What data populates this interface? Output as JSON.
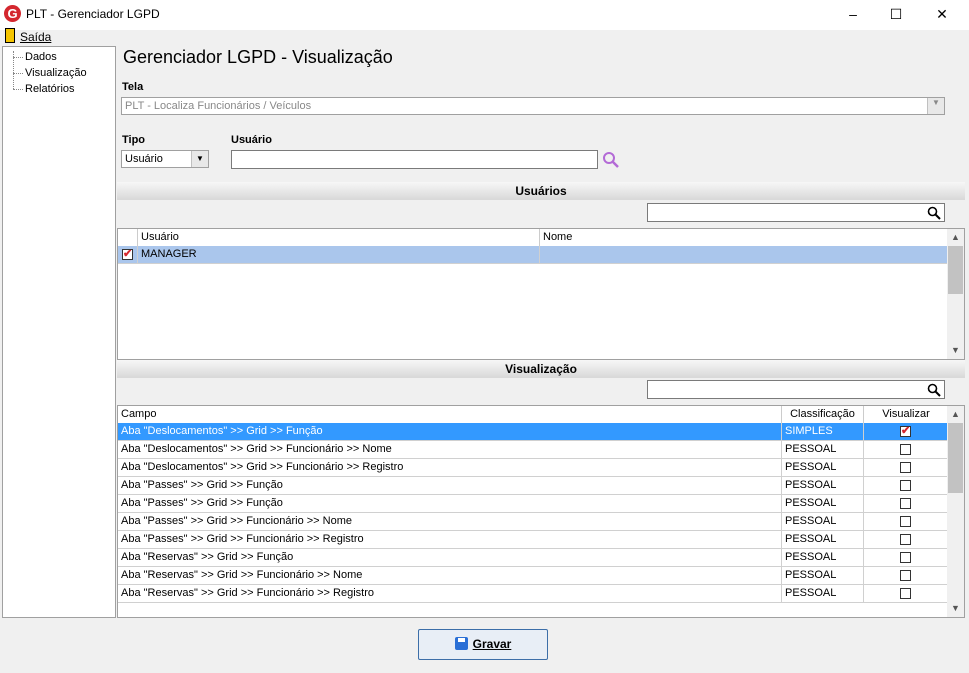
{
  "window": {
    "title": "PLT - Gerenciador LGPD",
    "logo_letter": "G",
    "minimize": "–",
    "maximize": "☐",
    "close": "✕"
  },
  "menu": {
    "saida": "Saída"
  },
  "tree": {
    "items": [
      "Dados",
      "Visualização",
      "Relatórios"
    ]
  },
  "page": {
    "title": "Gerenciador LGPD - Visualização"
  },
  "tela": {
    "label": "Tela",
    "value": "PLT - Localiza Funcionários / Veículos"
  },
  "tipo": {
    "label": "Tipo",
    "value": "Usuário"
  },
  "usuario": {
    "label": "Usuário",
    "value": ""
  },
  "usuarios_section": {
    "title": "Usuários",
    "columns": [
      "Usuário",
      "Nome"
    ],
    "rows": [
      {
        "checked": true,
        "usuario": "MANAGER",
        "nome": ""
      }
    ]
  },
  "visualizacao_section": {
    "title": "Visualização",
    "columns": [
      "Campo",
      "Classificação",
      "Visualizar"
    ],
    "rows": [
      {
        "campo": "Aba \"Deslocamentos\" >> Grid >> Função",
        "classificacao": "SIMPLES",
        "visualizar": true
      },
      {
        "campo": "Aba \"Deslocamentos\" >> Grid >> Funcionário >> Nome",
        "classificacao": "PESSOAL",
        "visualizar": false
      },
      {
        "campo": "Aba \"Deslocamentos\" >> Grid >> Funcionário >> Registro",
        "classificacao": "PESSOAL",
        "visualizar": false
      },
      {
        "campo": "Aba \"Passes\" >> Grid >> Função",
        "classificacao": "PESSOAL",
        "visualizar": false
      },
      {
        "campo": "Aba \"Passes\" >> Grid >> Função",
        "classificacao": "PESSOAL",
        "visualizar": false
      },
      {
        "campo": "Aba \"Passes\" >> Grid >> Funcionário >> Nome",
        "classificacao": "PESSOAL",
        "visualizar": false
      },
      {
        "campo": "Aba \"Passes\" >> Grid >> Funcionário >> Registro",
        "classificacao": "PESSOAL",
        "visualizar": false
      },
      {
        "campo": "Aba \"Reservas\" >> Grid >> Função",
        "classificacao": "PESSOAL",
        "visualizar": false
      },
      {
        "campo": "Aba \"Reservas\" >> Grid >> Funcionário >> Nome",
        "classificacao": "PESSOAL",
        "visualizar": false
      },
      {
        "campo": "Aba \"Reservas\" >> Grid >> Funcionário >> Registro",
        "classificacao": "PESSOAL",
        "visualizar": false
      }
    ]
  },
  "actions": {
    "gravar": "Gravar"
  },
  "colors": {
    "selected_row": "#3399ff",
    "selected_row_light": "#aac6ec",
    "accent_red": "#d4272e"
  }
}
